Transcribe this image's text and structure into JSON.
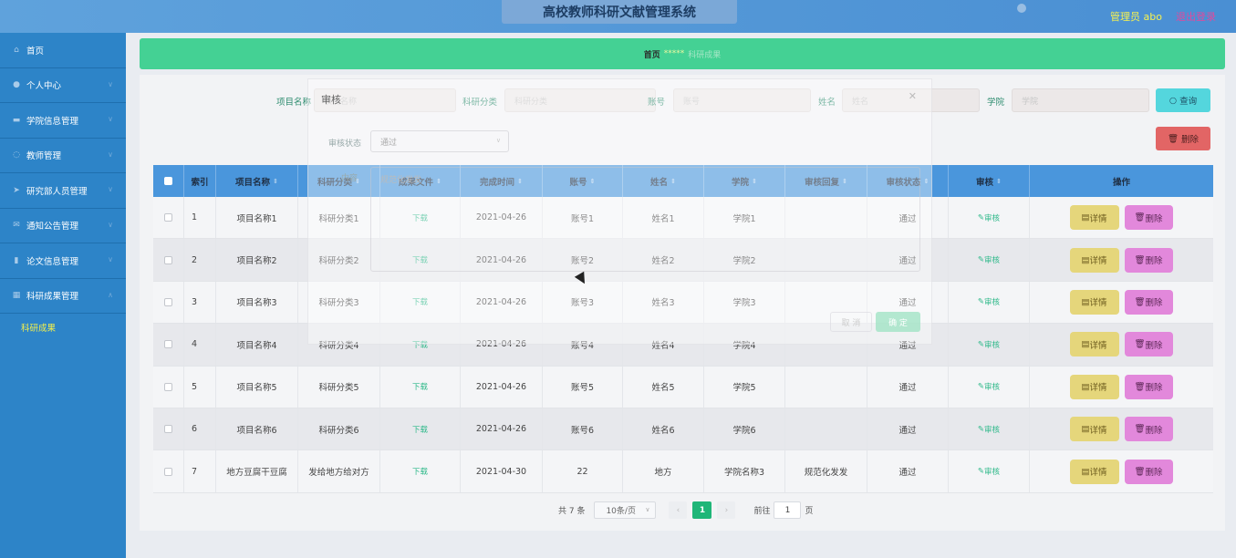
{
  "header": {
    "title": "高校教师科研文献管理系统",
    "admin_label": "管理员 abo",
    "logout_label": "退出登录"
  },
  "sidebar": {
    "items": [
      {
        "label": "首页",
        "icon": "home-icon"
      },
      {
        "label": "个人中心",
        "icon": "user-icon"
      },
      {
        "label": "学院信息管理",
        "icon": "building-icon"
      },
      {
        "label": "教师管理",
        "icon": "teacher-icon"
      },
      {
        "label": "研究部人员管理",
        "icon": "send-icon"
      },
      {
        "label": "通知公告管理",
        "icon": "mail-icon"
      },
      {
        "label": "论文信息管理",
        "icon": "doc-icon"
      },
      {
        "label": "科研成果管理",
        "icon": "chart-icon"
      }
    ],
    "sub_item": "科研成果"
  },
  "breadcrumb": {
    "home": "首页",
    "sep": "*****",
    "current": "科研成果"
  },
  "filters": {
    "project_label": "项目名称",
    "project_placeholder": "项目名称",
    "category_label": "科研分类",
    "category_placeholder": "科研分类",
    "account_label": "账号",
    "account_placeholder": "账号",
    "name_label": "姓名",
    "name_placeholder": "姓名",
    "college_label": "学院",
    "college_placeholder": "学院",
    "search_label": "查询",
    "delete_label": "删除"
  },
  "table": {
    "headers": [
      "索引",
      "项目名称",
      "科研分类",
      "成果文件",
      "完成时间",
      "账号",
      "姓名",
      "学院",
      "审核回复",
      "审核状态",
      "审核",
      "操作"
    ],
    "rows": [
      {
        "idx": "1",
        "project": "项目名称1",
        "category": "科研分类1",
        "file": "下载",
        "date": "2021-04-26",
        "account": "账号1",
        "name": "姓名1",
        "college": "学院1",
        "reply": "",
        "status": "通过",
        "audit": "审核"
      },
      {
        "idx": "2",
        "project": "项目名称2",
        "category": "科研分类2",
        "file": "下载",
        "date": "2021-04-26",
        "account": "账号2",
        "name": "姓名2",
        "college": "学院2",
        "reply": "",
        "status": "通过",
        "audit": "审核"
      },
      {
        "idx": "3",
        "project": "项目名称3",
        "category": "科研分类3",
        "file": "下载",
        "date": "2021-04-26",
        "account": "账号3",
        "name": "姓名3",
        "college": "学院3",
        "reply": "",
        "status": "通过",
        "audit": "审核"
      },
      {
        "idx": "4",
        "project": "项目名称4",
        "category": "科研分类4",
        "file": "下载",
        "date": "2021-04-26",
        "account": "账号4",
        "name": "姓名4",
        "college": "学院4",
        "reply": "",
        "status": "通过",
        "audit": "审核"
      },
      {
        "idx": "5",
        "project": "项目名称5",
        "category": "科研分类5",
        "file": "下载",
        "date": "2021-04-26",
        "account": "账号5",
        "name": "姓名5",
        "college": "学院5",
        "reply": "",
        "status": "通过",
        "audit": "审核"
      },
      {
        "idx": "6",
        "project": "项目名称6",
        "category": "科研分类6",
        "file": "下载",
        "date": "2021-04-26",
        "account": "账号6",
        "name": "姓名6",
        "college": "学院6",
        "reply": "",
        "status": "通过",
        "audit": "审核"
      },
      {
        "idx": "7",
        "project": "地方豆腐干豆腐",
        "category": "发给地方给对方",
        "file": "下载",
        "date": "2021-04-30",
        "account": "22",
        "name": "地方",
        "college": "学院名称3",
        "reply": "规范化发发",
        "status": "通过",
        "audit": "审核"
      }
    ],
    "detail_label": "详情",
    "delete_label": "删除"
  },
  "pagination": {
    "total": "共 7 条",
    "page_size": "10条/页",
    "current_page": "1",
    "goto_label": "前往",
    "goto_value": "1",
    "page_suffix": "页"
  },
  "dialog": {
    "title": "审核",
    "status_label": "审核状态",
    "status_value": "通过",
    "content_label": "内容",
    "content_value": "规范化发发",
    "cancel_label": "取 消",
    "ok_label": "确 定"
  }
}
